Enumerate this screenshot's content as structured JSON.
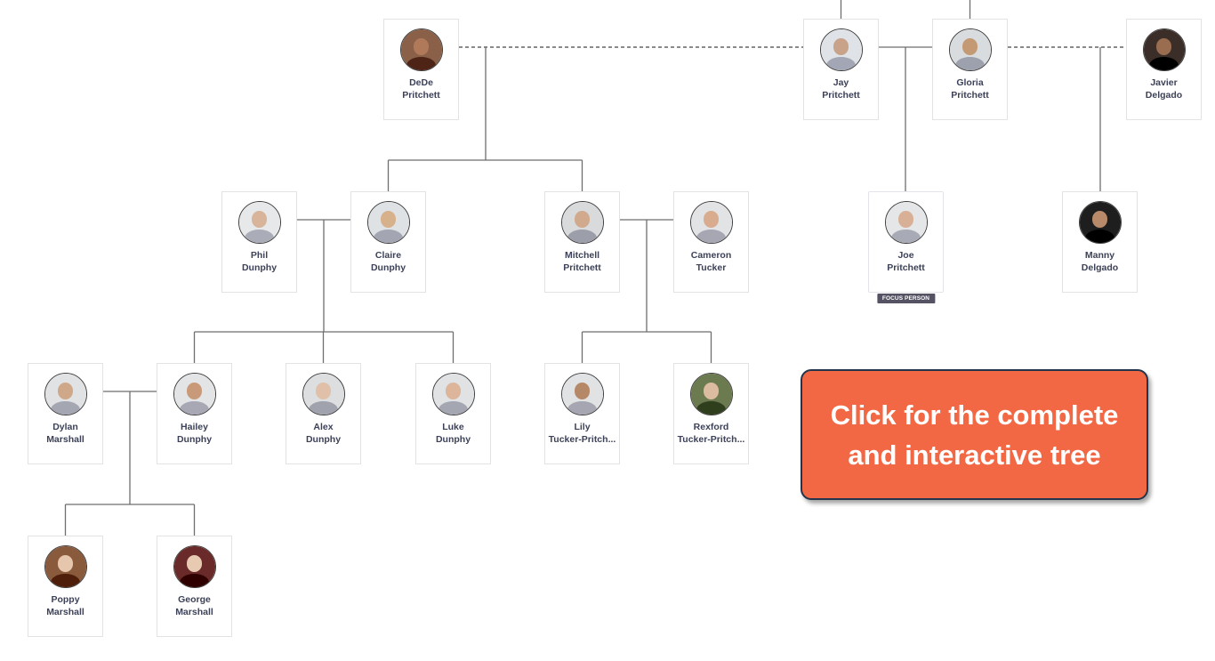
{
  "tree": {
    "people": [
      {
        "id": "dede",
        "first": "DeDe",
        "last": "Pritchett",
        "avatar_tone": "#b07a5a",
        "avatar_bg": "#8a6048"
      },
      {
        "id": "jay",
        "first": "Jay",
        "last": "Pritchett",
        "avatar_tone": "#c9a28a",
        "avatar_bg": "#dfe2e6"
      },
      {
        "id": "gloria",
        "first": "Gloria",
        "last": "Pritchett",
        "avatar_tone": "#c49a74",
        "avatar_bg": "#d9dcdf"
      },
      {
        "id": "javier",
        "first": "Javier",
        "last": "Delgado",
        "avatar_tone": "#9a6c50",
        "avatar_bg": "#3b2e28"
      },
      {
        "id": "phil",
        "first": "Phil",
        "last": "Dunphy",
        "avatar_tone": "#d8b49a",
        "avatar_bg": "#e6e8ea"
      },
      {
        "id": "claire",
        "first": "Claire",
        "last": "Dunphy",
        "avatar_tone": "#d7b08c",
        "avatar_bg": "#dfe2e4"
      },
      {
        "id": "mitchell",
        "first": "Mitchell",
        "last": "Pritchett",
        "avatar_tone": "#d1aa8e",
        "avatar_bg": "#d8dadc"
      },
      {
        "id": "cameron",
        "first": "Cameron",
        "last": "Tucker",
        "avatar_tone": "#d9ac90",
        "avatar_bg": "#e2e3e5"
      },
      {
        "id": "joe",
        "first": "Joe",
        "last": "Pritchett",
        "avatar_tone": "#d8b096",
        "avatar_bg": "#e4e6e8",
        "focus": true
      },
      {
        "id": "manny",
        "first": "Manny",
        "last": "Delgado",
        "avatar_tone": "#b88a6a",
        "avatar_bg": "#1e1e1e"
      },
      {
        "id": "dylan",
        "first": "Dylan",
        "last": "Marshall",
        "avatar_tone": "#cfa88a",
        "avatar_bg": "#e0e2e4"
      },
      {
        "id": "hailey",
        "first": "Hailey",
        "last": "Dunphy",
        "avatar_tone": "#c99a7a",
        "avatar_bg": "#e3e4e6"
      },
      {
        "id": "alex",
        "first": "Alex",
        "last": "Dunphy",
        "avatar_tone": "#e0c0a8",
        "avatar_bg": "#dcdedf"
      },
      {
        "id": "luke",
        "first": "Luke",
        "last": "Dunphy",
        "avatar_tone": "#dcb59a",
        "avatar_bg": "#e0e2e4"
      },
      {
        "id": "lily",
        "first": "Lily",
        "last": "Tucker-Pritch...",
        "avatar_tone": "#b58868",
        "avatar_bg": "#e1e2e3"
      },
      {
        "id": "rexford",
        "first": "Rexford",
        "last": "Tucker-Pritch...",
        "avatar_tone": "#dcbca0",
        "avatar_bg": "#6b7a4f"
      },
      {
        "id": "poppy",
        "first": "Poppy",
        "last": "Marshall",
        "avatar_tone": "#e6c6ac",
        "avatar_bg": "#8a5a3c"
      },
      {
        "id": "george",
        "first": "George",
        "last": "Marshall",
        "avatar_tone": "#e8cab2",
        "avatar_bg": "#6a2a2a"
      }
    ],
    "couples": [
      {
        "partners": [
          "dede",
          "jay"
        ],
        "status": "divorced",
        "children": [
          "claire",
          "mitchell"
        ]
      },
      {
        "partners": [
          "jay",
          "gloria"
        ],
        "status": "married",
        "children": [
          "joe"
        ]
      },
      {
        "partners": [
          "gloria",
          "javier"
        ],
        "status": "divorced",
        "children": [
          "manny"
        ]
      },
      {
        "partners": [
          "phil",
          "claire"
        ],
        "status": "married",
        "children": [
          "hailey",
          "alex",
          "luke"
        ]
      },
      {
        "partners": [
          "mitchell",
          "cameron"
        ],
        "status": "married",
        "children": [
          "lily",
          "rexford"
        ]
      },
      {
        "partners": [
          "dylan",
          "hailey"
        ],
        "status": "married",
        "children": [
          "poppy",
          "george"
        ]
      }
    ],
    "focus_badge_label": "FOCUS PERSON"
  },
  "cta": {
    "line1": "Click for the complete",
    "line2": "and interactive tree",
    "color": "#f26845"
  },
  "colors": {
    "line": "#6e6e6e",
    "card_border": "#e3e3e3",
    "name_text": "#3c4158",
    "badge_bg": "#555264"
  }
}
